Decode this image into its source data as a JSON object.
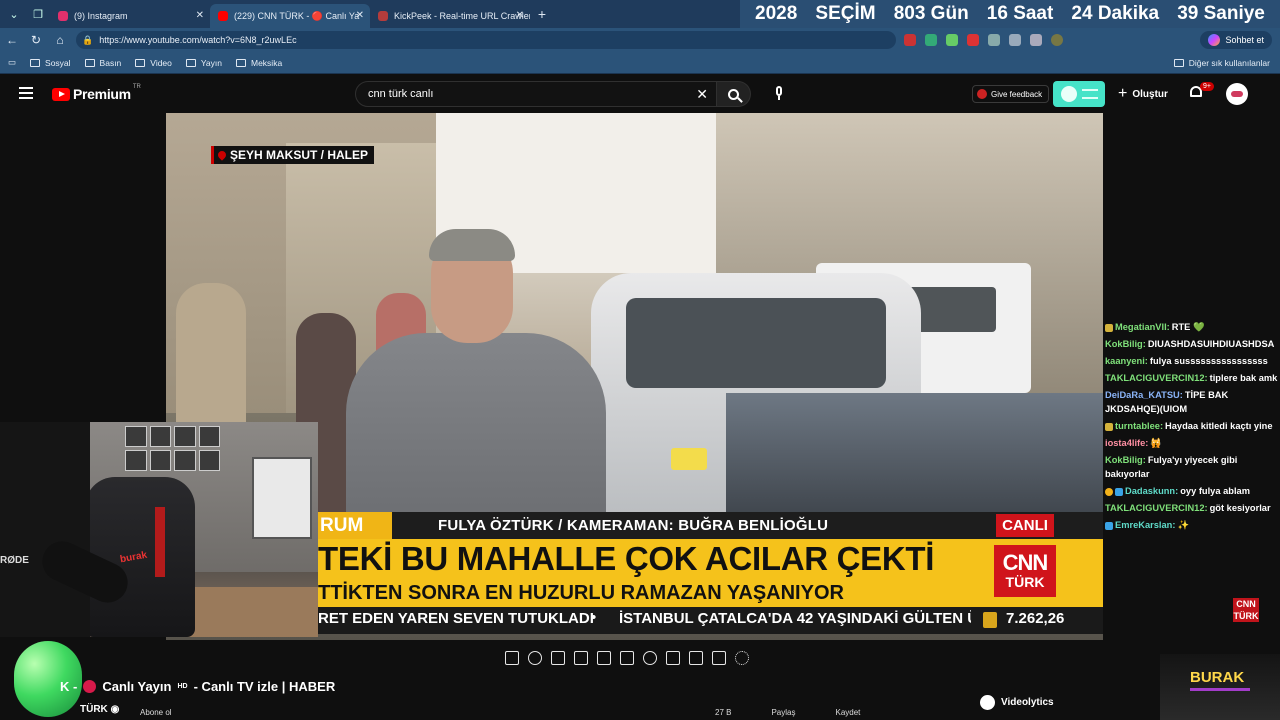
{
  "browser": {
    "tabs": [
      {
        "label": "(9) Instagram",
        "color": "#e1306c"
      },
      {
        "label": "(229) CNN TÜRK - 🔴 Canlı Ya",
        "color": "#ff0000"
      },
      {
        "label": "KickPeek - Real-time URL Crawler",
        "color": "#b43c3c"
      }
    ],
    "countdown": [
      "2028",
      "SEÇİM",
      "803 Gün",
      "16 Saat",
      "24 Dakika",
      "39 Saniye"
    ],
    "url": "https://www.youtube.com/watch?v=6N8_r2uwLEc",
    "copilot_label": "Sohbet et",
    "bookmarks": [
      "Sosyal",
      "Basın",
      "Video",
      "Yayın",
      "Meksika"
    ],
    "other_bookmarks": "Diğer sık kullanılanlar"
  },
  "youtube": {
    "logo": "Premium",
    "region": "TR",
    "search_value": "cnn türk canlı",
    "feedback": "Give feedback",
    "create": "Oluştur",
    "notifications": "9+"
  },
  "video": {
    "location_tag": "ŞEYH MAKSUT / HALEP",
    "tag_left": "RUM",
    "credit": "FULYA ÖZTÜRK / KAMERAMAN: BUĞRA BENLİOĞLU",
    "live": "CANLI",
    "headline": "TEKİ BU MAHALLE ÇOK ACILAR ÇEKTİ",
    "subheadline": "TTİKTEN SONRA EN HUZURLU RAMAZAN YAŞANIYOR",
    "ticker_left": "RET EDEN YAREN SEVEN TUTUKLADI",
    "ticker_bullet": "•",
    "ticker_right": "İSTANBUL ÇATALCA'DA 42 YAŞINDAKİ GÜLTEN Ü",
    "stock_value": "7.262,26",
    "cnn_line1": "CNN",
    "cnn_line2": "TÜRK"
  },
  "webcam": {
    "mic_label": "RØDE",
    "chair_brand": "burak"
  },
  "chat": [
    {
      "user": "MegatianVII:",
      "text": "RTE",
      "color": "#7fe07a",
      "heart": "💚"
    },
    {
      "user": "KokBilig:",
      "text": "DIUASHDASUIHDIUASHDSA",
      "color": "#7fe07a"
    },
    {
      "user": "kaanyeni:",
      "text": "fulya sussssssssssssssss",
      "color": "#7fe07a"
    },
    {
      "user": "TAKLACIGUVERCIN12:",
      "text": "tiplere bak amk",
      "color": "#7fe07a"
    },
    {
      "user": "DeiDaRa_KATSU:",
      "text": "TİPE BAK JKDSAHQE)(UIOM",
      "color": "#8ab4f8"
    },
    {
      "user": "turntablee:",
      "text": "Haydaa kitledi kaçtı yine",
      "color": "#7fe07a"
    },
    {
      "user": "iosta4life:",
      "text": "🙀",
      "color": "#ff8fa3"
    },
    {
      "user": "KokBilig:",
      "text": "Fulya'yı yiyecek gibi bakıyorlar",
      "color": "#7fe07a"
    },
    {
      "user": "Dadaskunn:",
      "text": "oyy fulya ablam",
      "color": "#5fdbc9"
    },
    {
      "user": "TAKLACIGUVERCIN12:",
      "text": "göt kesiyorlar",
      "color": "#7fe07a"
    },
    {
      "user": "EmreKarslan:",
      "text": "✨",
      "color": "#5fdbc9"
    }
  ],
  "below": {
    "title_prefix": "K -",
    "title": "Canlı Yayın",
    "title_sup": "HD",
    "title_suffix": "- Canlı TV izle | HABER",
    "channel": "TÜRK",
    "subscribe": "Abone ol",
    "likes": "27 B",
    "share": "Paylaş",
    "save": "Kaydet",
    "videolytics": "Videolytics",
    "overlay_name": "BURAK"
  }
}
